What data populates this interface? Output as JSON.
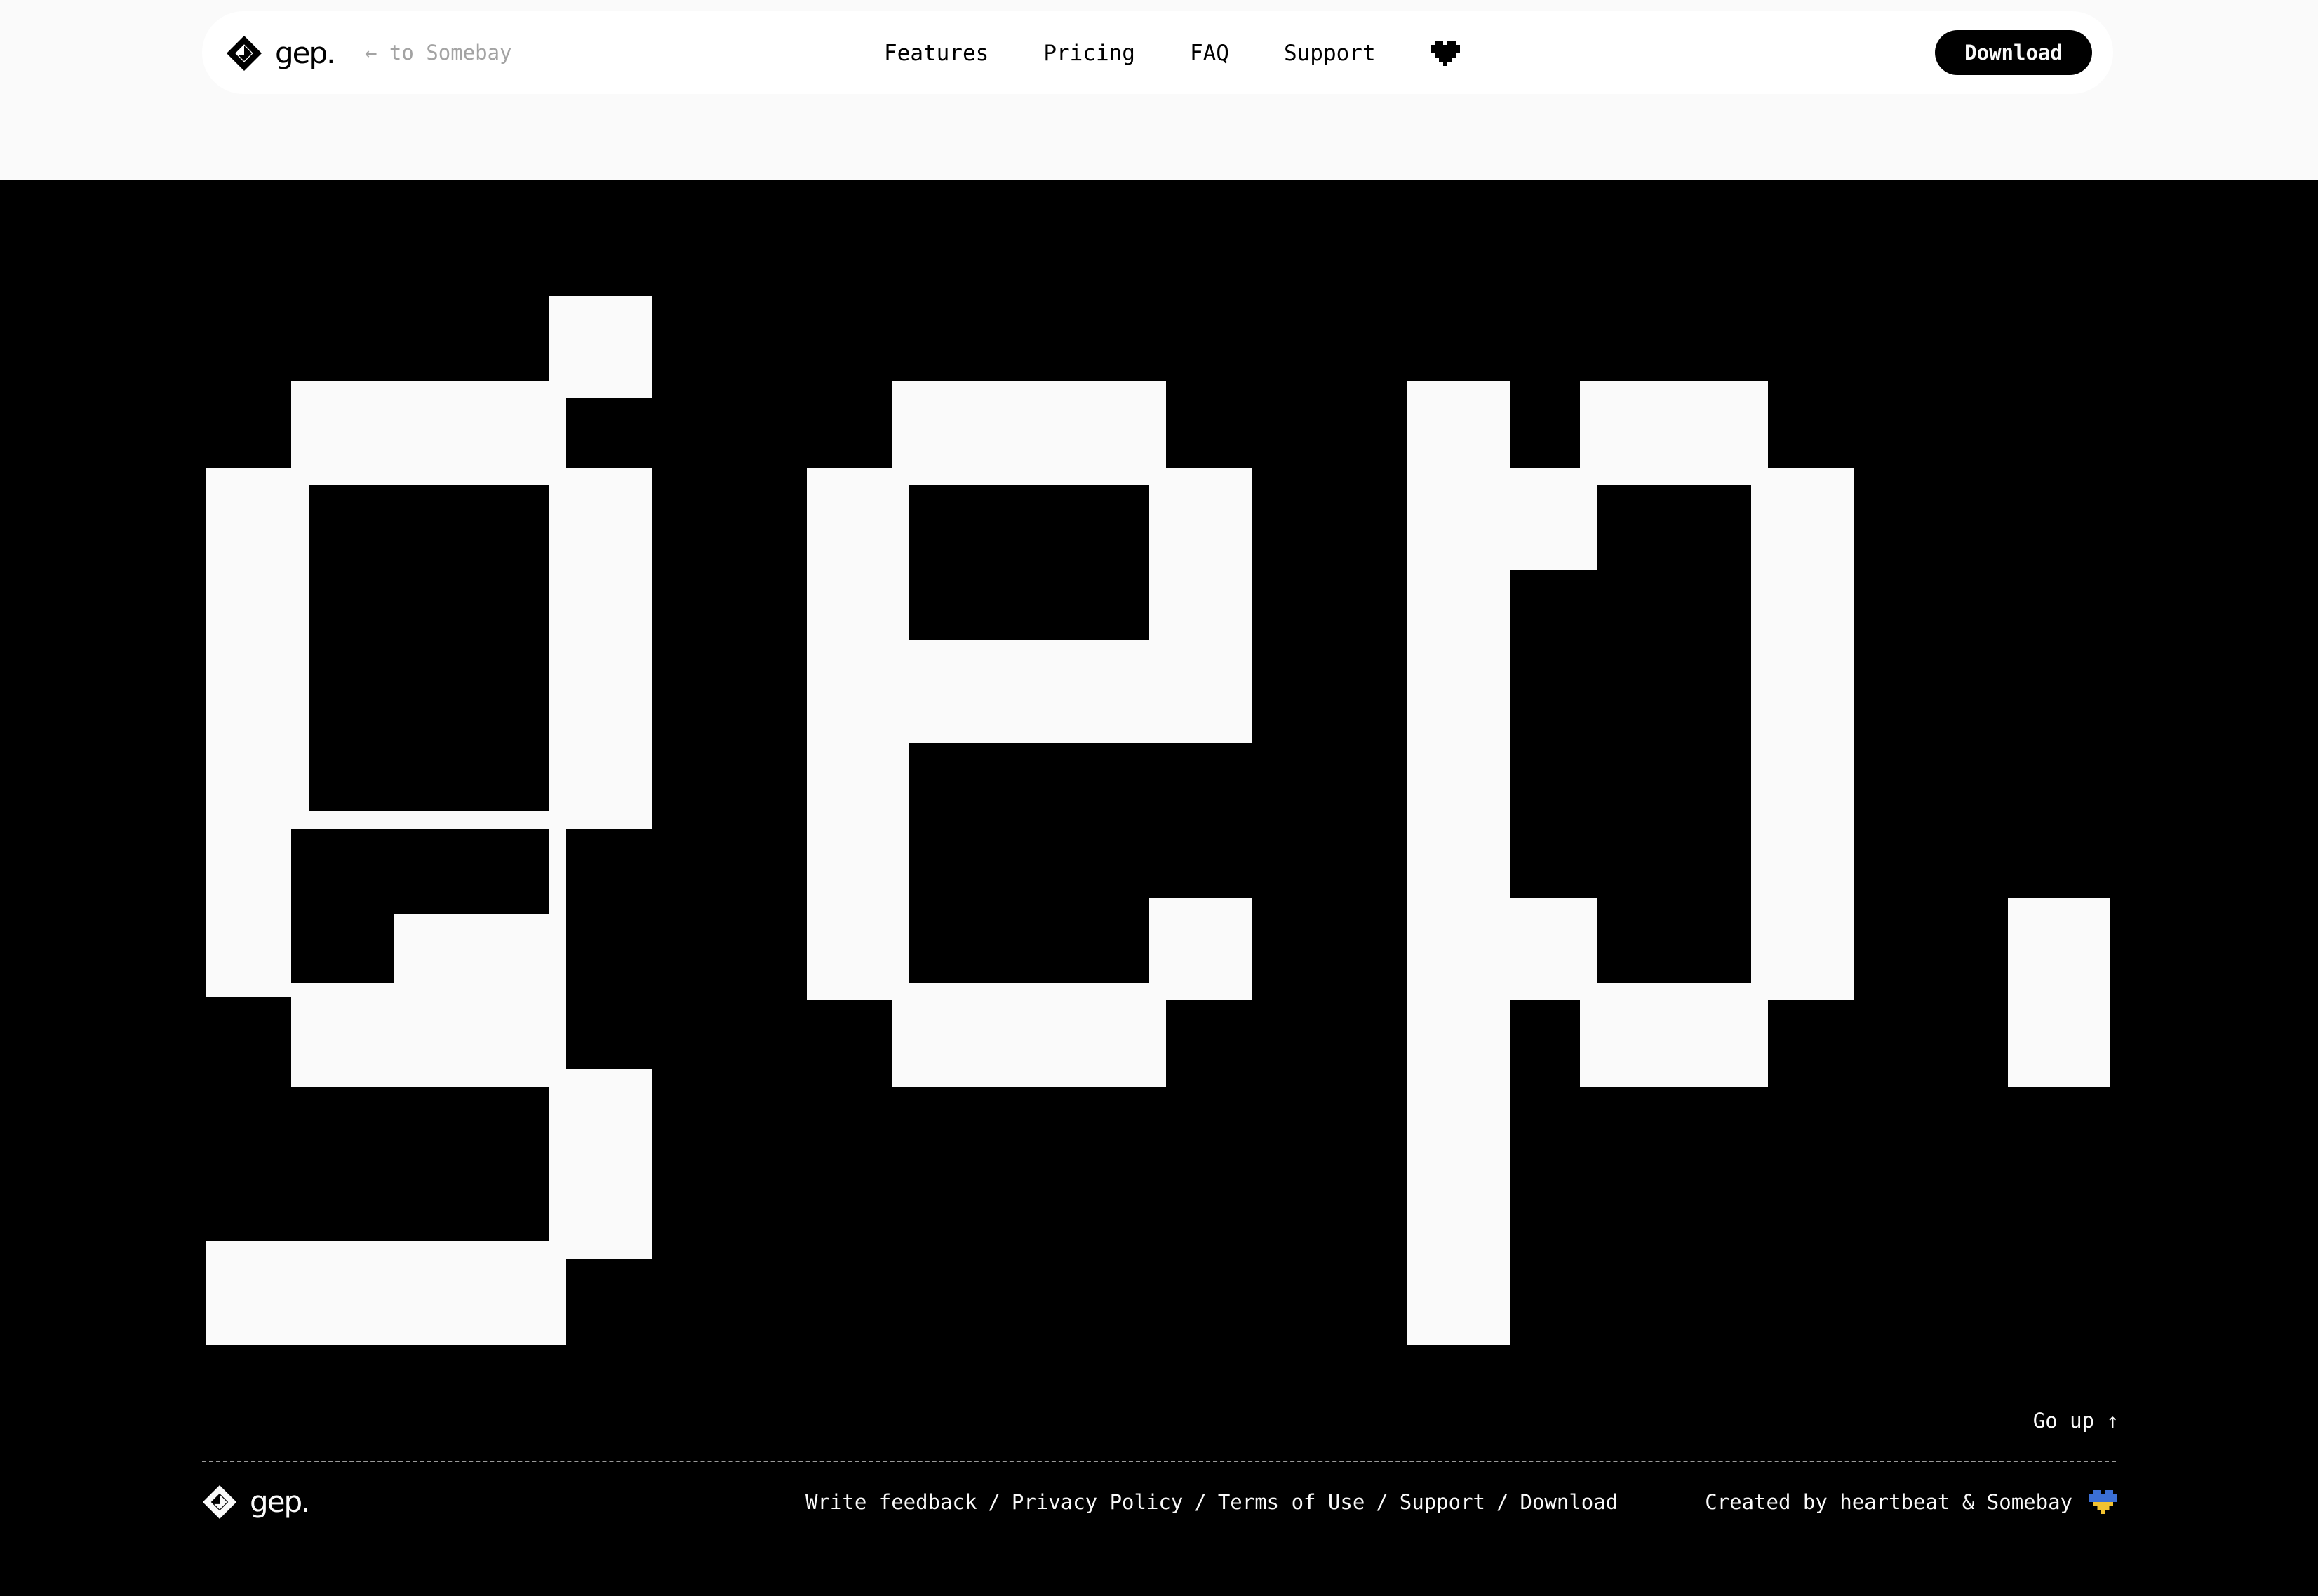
{
  "header": {
    "brand": "gep.",
    "back_link": "← to Somebay",
    "nav": [
      "Features",
      "Pricing",
      "FAQ",
      "Support"
    ],
    "download": "Download"
  },
  "hero": {
    "wordmark": "gep.",
    "colors": {
      "pixel": "#fafafa",
      "background": "#000000"
    }
  },
  "footer": {
    "go_up": "Go up ↑",
    "brand": "gep.",
    "links": [
      "Write feedback",
      "Privacy Policy",
      "Terms of Use",
      "Support",
      "Download"
    ],
    "separator": "/",
    "credits": "Created by heartbeat & Somebay",
    "flag_colors": [
      "#3b6fd6",
      "#f2c230"
    ]
  },
  "colors": {
    "accent": "#000000",
    "page_background": "#fafafa",
    "footer_text": "#fafafa"
  }
}
